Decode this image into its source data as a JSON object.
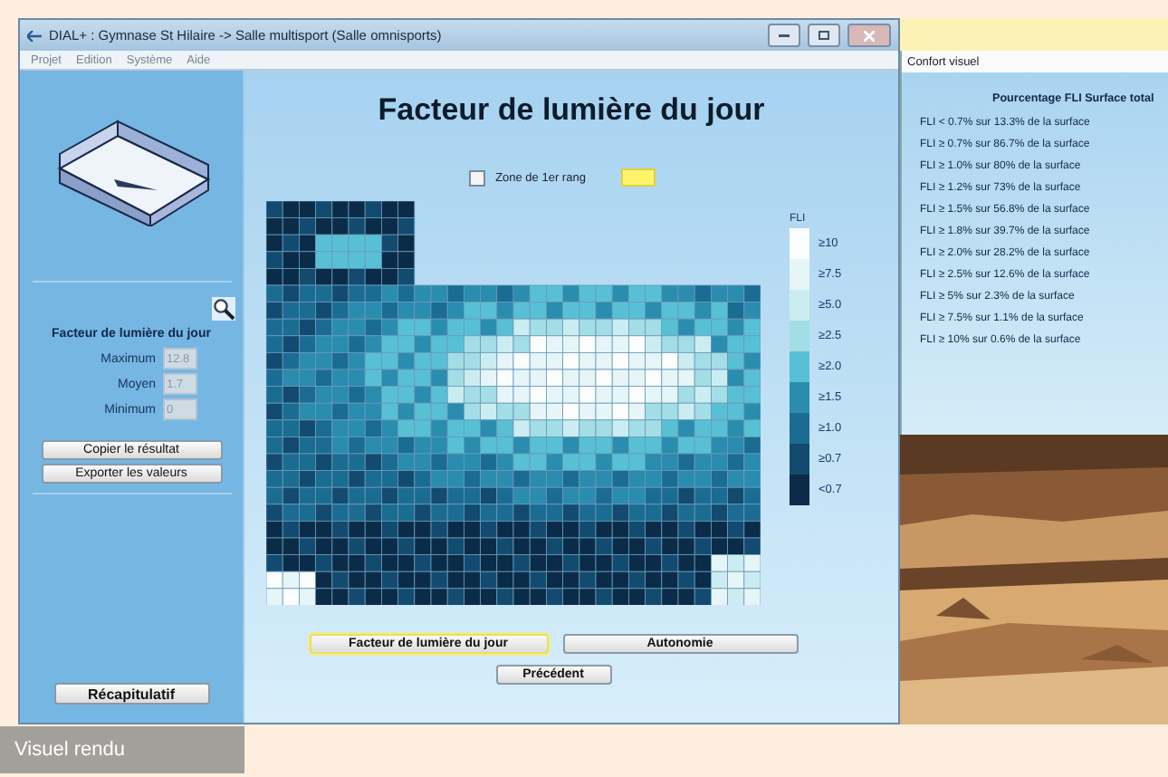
{
  "main_window": {
    "title": "DIAL+ : Gymnase St Hilaire -> Salle multisport (Salle omnisports)",
    "menu": [
      "Projet",
      "Edition",
      "Système",
      "Aide"
    ],
    "side_panel": {
      "heading": "Facteur de lumière du jour",
      "fields": [
        {
          "label": "Maximum",
          "value": "12.8",
          "disabled": true
        },
        {
          "label": "Moyen",
          "value": "1.7",
          "disabled": true
        },
        {
          "label": "Minimum",
          "value": "0",
          "disabled": true
        }
      ],
      "buttons": [
        "Copier le résultat",
        "Exporter les valeurs"
      ],
      "summary_button": "Récapitulatif"
    },
    "heading": "Facteur de lumière du jour",
    "zone_checkbox": {
      "label": "Zone de 1er rang",
      "checked": false
    },
    "legend": {
      "title": "FLI",
      "items": [
        {
          "label": "≥10",
          "color": "#fbfdfd"
        },
        {
          "label": "≥7.5",
          "color": "#e6f5f7"
        },
        {
          "label": "≥5.0",
          "color": "#cbedf1"
        },
        {
          "label": "≥2.5",
          "color": "#a3dde6"
        },
        {
          "label": "≥2.0",
          "color": "#58c0d4"
        },
        {
          "label": "≥1.5",
          "color": "#2a8cae"
        },
        {
          "label": "≥1.0",
          "color": "#1b6c93"
        },
        {
          "label": "≥0.7",
          "color": "#134b70"
        },
        {
          "label": "<0.7",
          "color": "#0b2c48"
        }
      ]
    },
    "tabs": [
      {
        "label": "Facteur de lumière du jour",
        "selected": true
      },
      {
        "label": "Autonomie",
        "selected": false
      }
    ],
    "back_button": "Précédent"
  },
  "comfort_window": {
    "title": "Confort visuel",
    "heading": "Pourcentage FLI Surface total",
    "lines": [
      "FLI < 0.7% sur 13.3% de la surface",
      "FLI ≥ 0.7% sur 86.7% de la surface",
      "FLI ≥ 1.0% sur 80% de la surface",
      "FLI ≥ 1.2% sur 73% de la surface",
      "FLI ≥ 1.5% sur 56.8% de la surface",
      "FLI ≥ 1.8% sur 39.7% de la surface",
      "FLI ≥ 2.0% sur 28.2% de la surface",
      "FLI ≥ 2.5% sur 12.6% de la surface",
      "FLI ≥ 5% sur 2.3% de la surface",
      "FLI ≥ 7.5% sur 1.1% de la surface",
      "FLI ≥ 10% sur 0.6% de la surface"
    ]
  },
  "caption": "Visuel rendu"
}
